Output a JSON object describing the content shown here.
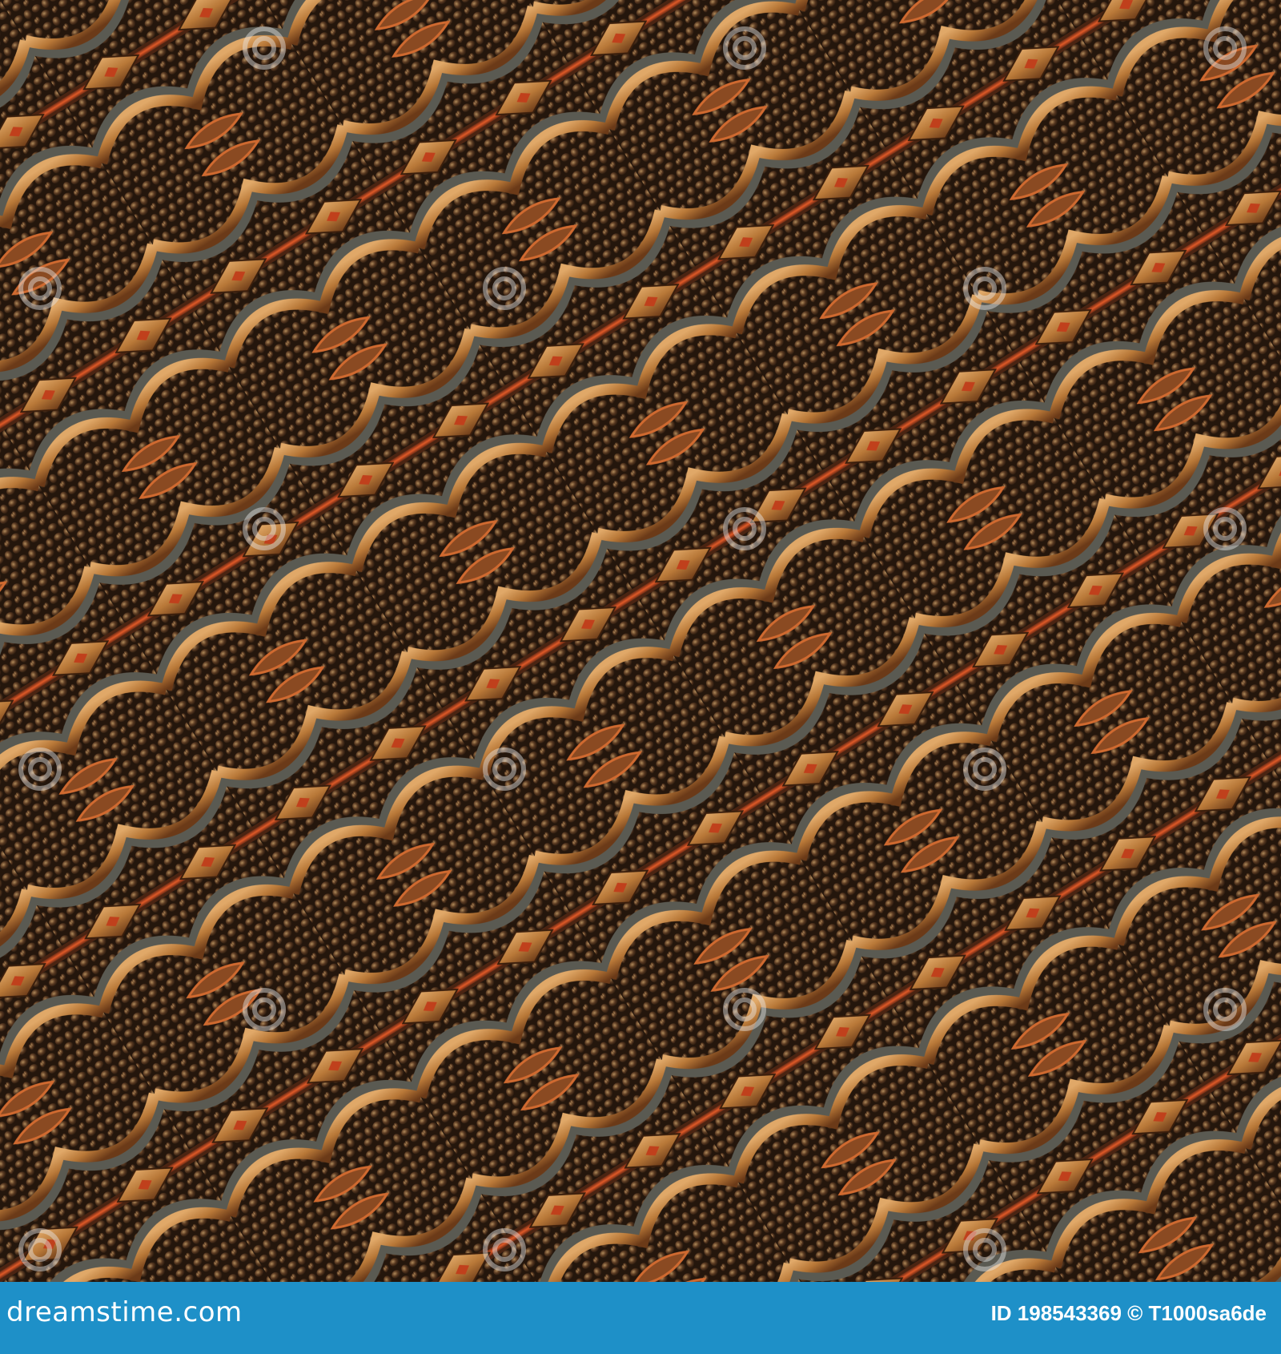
{
  "image": {
    "subject": "seamless decorative pattern of bronze diagonal chains with diamond links and scalloped arcs",
    "palette": {
      "background": "#2b1a10",
      "bronze": "#c88a48",
      "bronze_dark": "#6b3a18",
      "slate": "#5a5a52",
      "accent_red": "#c0401c",
      "cobble": "#4a3220"
    }
  },
  "watermark": {
    "text": "dreamstime",
    "icon": "spiral-logo-icon"
  },
  "footer": {
    "brand": "dreamstime.com",
    "id_label": "ID 198543369 © T1000sa6de",
    "background": "#1e90c8"
  }
}
